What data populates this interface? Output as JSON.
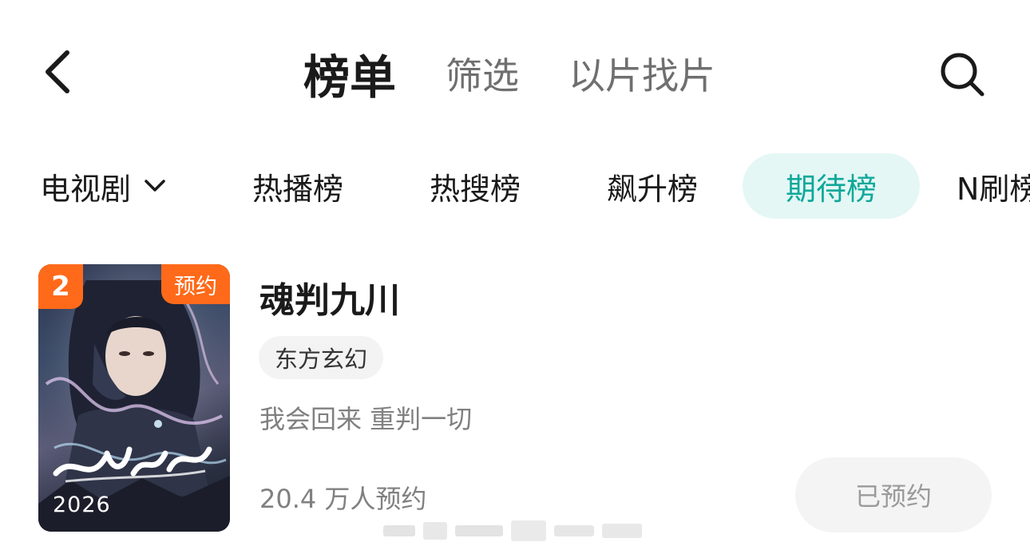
{
  "header": {
    "tabs": [
      {
        "label": "榜单",
        "active": true
      },
      {
        "label": "筛选",
        "active": false
      },
      {
        "label": "以片找片",
        "active": false
      }
    ],
    "back_icon": "chevron-left-icon",
    "search_icon": "search-icon"
  },
  "category": {
    "selector_label": "电视剧",
    "selector_icon": "chevron-down-icon",
    "tabs": [
      {
        "label": "热播榜",
        "active": false
      },
      {
        "label": "热搜榜",
        "active": false
      },
      {
        "label": "飙升榜",
        "active": false
      },
      {
        "label": "期待榜",
        "active": true
      },
      {
        "label": "N刷榜",
        "active": false
      }
    ],
    "accent_color": "#10a89a",
    "active_bg": "#e4f7f5"
  },
  "item": {
    "rank": "2",
    "status_tag": "预约",
    "poster_year": "2026",
    "title": "魂判九川",
    "genre": "东方玄幻",
    "tagline": "我会回来 重判一切",
    "reserve_count": "20.4 万人预约",
    "button_label": "已预约",
    "badge_color": "#ff6a1a"
  }
}
